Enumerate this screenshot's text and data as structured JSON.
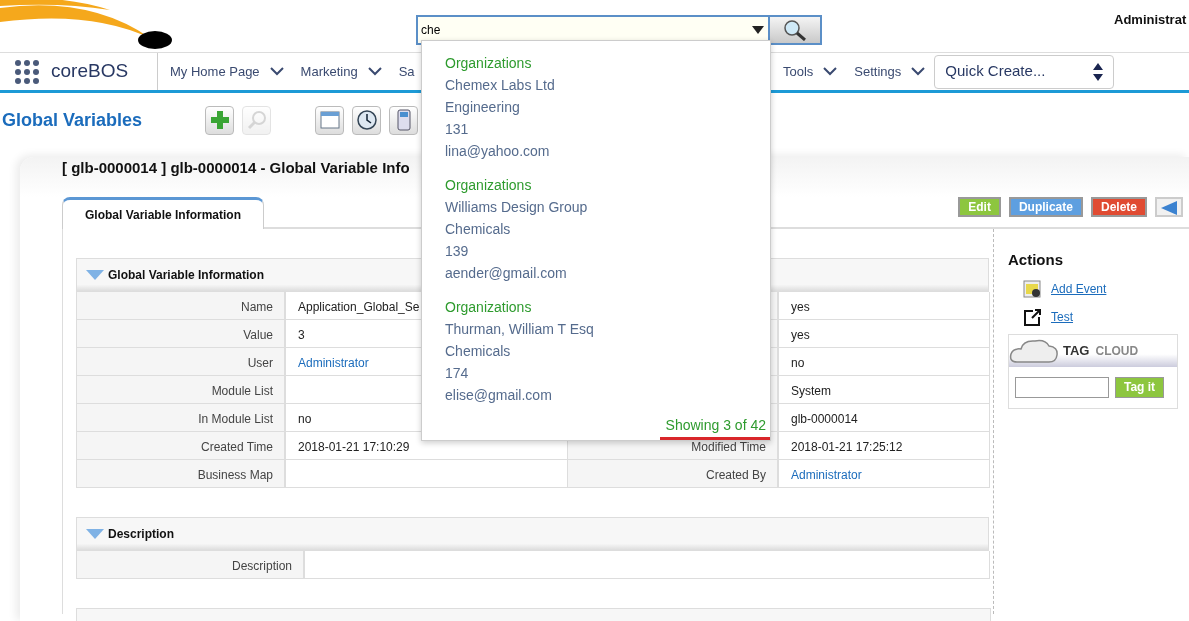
{
  "header": {
    "search": {
      "value": "che"
    },
    "user": "Administrat"
  },
  "nav": {
    "brand": "coreBOS",
    "left_items": [
      {
        "label": "My Home Page",
        "caret": true
      },
      {
        "label": "Marketing",
        "caret": true
      },
      {
        "label": "Sa",
        "caret": false
      }
    ],
    "right_items": [
      {
        "label": "Tools",
        "caret": true
      },
      {
        "label": "Settings",
        "caret": true
      }
    ],
    "quick_create": "Quick Create..."
  },
  "page_title": "Global Variables",
  "toolbar": [
    {
      "kind": "add",
      "disabled": false
    },
    {
      "kind": "search",
      "disabled": true
    },
    {
      "kind": "calendar",
      "disabled": false
    },
    {
      "kind": "clock",
      "disabled": false
    },
    {
      "kind": "calculator",
      "disabled": false
    }
  ],
  "record": {
    "title": "[ glb-0000014 ] glb-0000014 - Global Variable Info",
    "tabs": [
      {
        "label": "Global Variable Information",
        "selected": true
      }
    ],
    "buttons": [
      {
        "kind": "edit",
        "label": "Edit"
      },
      {
        "kind": "duplicate",
        "label": "Duplicate"
      },
      {
        "kind": "delete",
        "label": "Delete"
      },
      {
        "kind": "back"
      }
    ],
    "blocks": [
      {
        "title": "Global Variable Information",
        "expanded": true,
        "rows": [
          [
            {
              "kind": "label",
              "text": "Name"
            },
            {
              "kind": "value",
              "text": "Application_Global_Se"
            },
            {
              "kind": "label"
            },
            {
              "kind": "value",
              "text": "yes"
            }
          ],
          [
            {
              "kind": "label",
              "text": "Value"
            },
            {
              "kind": "value",
              "text": "3"
            },
            {
              "kind": "label"
            },
            {
              "kind": "value",
              "text": "yes"
            }
          ],
          [
            {
              "kind": "label",
              "text": "User"
            },
            {
              "kind": "link",
              "text": "Administrator"
            },
            {
              "kind": "label"
            },
            {
              "kind": "value",
              "text": "no"
            }
          ],
          [
            {
              "kind": "label",
              "text": "Module List"
            },
            {
              "kind": "value"
            },
            {
              "kind": "label"
            },
            {
              "kind": "value",
              "text": "System"
            }
          ],
          [
            {
              "kind": "label",
              "text": "In Module List"
            },
            {
              "kind": "value",
              "text": "no"
            },
            {
              "kind": "label"
            },
            {
              "kind": "value",
              "text": "glb-0000014"
            }
          ],
          [
            {
              "kind": "label",
              "text": "Created Time"
            },
            {
              "kind": "value",
              "text": "2018-01-21 17:10:29"
            },
            {
              "kind": "label",
              "text": "Modified Time"
            },
            {
              "kind": "value",
              "text": "2018-01-21 17:25:12"
            }
          ],
          [
            {
              "kind": "label",
              "text": "Business Map"
            },
            {
              "kind": "value"
            },
            {
              "kind": "label",
              "text": "Created By"
            },
            {
              "kind": "link",
              "text": "Administrator"
            }
          ]
        ]
      },
      {
        "title": "Description",
        "expanded": true,
        "rows": [
          [
            {
              "kind": "label",
              "text": "Description"
            },
            {
              "kind": "value"
            }
          ]
        ]
      }
    ]
  },
  "actions": {
    "title": "Actions",
    "links": [
      {
        "kind": "event",
        "label": "Add Event"
      },
      {
        "kind": "external",
        "label": "Test"
      }
    ]
  },
  "tag_cloud": {
    "title_main": "TAG",
    "title_sub": "CLOUD",
    "button": "Tag it"
  },
  "search_results": {
    "groups": [
      {
        "module": "Organizations",
        "lines": [
          "Chemex Labs Ltd",
          "Engineering",
          "131",
          "lina@yahoo.com"
        ]
      },
      {
        "module": "Organizations",
        "lines": [
          "Williams Design Group",
          "Chemicals",
          "139",
          "aender@gmail.com"
        ]
      },
      {
        "module": "Organizations",
        "lines": [
          "Thurman, William T Esq",
          "Chemicals",
          "174",
          "elise@gmail.com"
        ]
      }
    ],
    "footer": "Showing 3 of 42"
  }
}
